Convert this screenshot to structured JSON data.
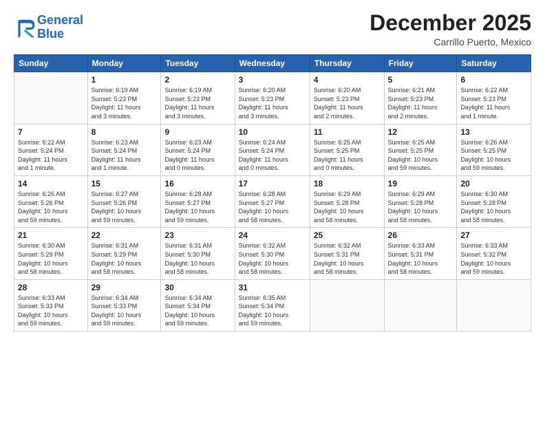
{
  "header": {
    "logo_line1": "General",
    "logo_line2": "Blue",
    "month": "December 2025",
    "location": "Carrillo Puerto, Mexico"
  },
  "weekdays": [
    "Sunday",
    "Monday",
    "Tuesday",
    "Wednesday",
    "Thursday",
    "Friday",
    "Saturday"
  ],
  "weeks": [
    [
      {
        "day": "",
        "info": ""
      },
      {
        "day": "1",
        "info": "Sunrise: 6:19 AM\nSunset: 5:23 PM\nDaylight: 11 hours\nand 3 minutes."
      },
      {
        "day": "2",
        "info": "Sunrise: 6:19 AM\nSunset: 5:23 PM\nDaylight: 11 hours\nand 3 minutes."
      },
      {
        "day": "3",
        "info": "Sunrise: 6:20 AM\nSunset: 5:23 PM\nDaylight: 11 hours\nand 3 minutes."
      },
      {
        "day": "4",
        "info": "Sunrise: 6:20 AM\nSunset: 5:23 PM\nDaylight: 11 hours\nand 2 minutes."
      },
      {
        "day": "5",
        "info": "Sunrise: 6:21 AM\nSunset: 5:23 PM\nDaylight: 11 hours\nand 2 minutes."
      },
      {
        "day": "6",
        "info": "Sunrise: 6:22 AM\nSunset: 5:23 PM\nDaylight: 11 hours\nand 1 minute."
      }
    ],
    [
      {
        "day": "7",
        "info": "Sunrise: 6:22 AM\nSunset: 5:24 PM\nDaylight: 11 hours\nand 1 minute."
      },
      {
        "day": "8",
        "info": "Sunrise: 6:23 AM\nSunset: 5:24 PM\nDaylight: 11 hours\nand 1 minute."
      },
      {
        "day": "9",
        "info": "Sunrise: 6:23 AM\nSunset: 5:24 PM\nDaylight: 11 hours\nand 0 minutes."
      },
      {
        "day": "10",
        "info": "Sunrise: 6:24 AM\nSunset: 5:24 PM\nDaylight: 11 hours\nand 0 minutes."
      },
      {
        "day": "11",
        "info": "Sunrise: 6:25 AM\nSunset: 5:25 PM\nDaylight: 11 hours\nand 0 minutes."
      },
      {
        "day": "12",
        "info": "Sunrise: 6:25 AM\nSunset: 5:25 PM\nDaylight: 10 hours\nand 59 minutes."
      },
      {
        "day": "13",
        "info": "Sunrise: 6:26 AM\nSunset: 5:25 PM\nDaylight: 10 hours\nand 59 minutes."
      }
    ],
    [
      {
        "day": "14",
        "info": "Sunrise: 6:26 AM\nSunset: 5:26 PM\nDaylight: 10 hours\nand 59 minutes."
      },
      {
        "day": "15",
        "info": "Sunrise: 6:27 AM\nSunset: 5:26 PM\nDaylight: 10 hours\nand 59 minutes."
      },
      {
        "day": "16",
        "info": "Sunrise: 6:28 AM\nSunset: 5:27 PM\nDaylight: 10 hours\nand 59 minutes."
      },
      {
        "day": "17",
        "info": "Sunrise: 6:28 AM\nSunset: 5:27 PM\nDaylight: 10 hours\nand 58 minutes."
      },
      {
        "day": "18",
        "info": "Sunrise: 6:29 AM\nSunset: 5:28 PM\nDaylight: 10 hours\nand 58 minutes."
      },
      {
        "day": "19",
        "info": "Sunrise: 6:29 AM\nSunset: 5:28 PM\nDaylight: 10 hours\nand 58 minutes."
      },
      {
        "day": "20",
        "info": "Sunrise: 6:30 AM\nSunset: 5:28 PM\nDaylight: 10 hours\nand 58 minutes."
      }
    ],
    [
      {
        "day": "21",
        "info": "Sunrise: 6:30 AM\nSunset: 5:29 PM\nDaylight: 10 hours\nand 58 minutes."
      },
      {
        "day": "22",
        "info": "Sunrise: 6:31 AM\nSunset: 5:29 PM\nDaylight: 10 hours\nand 58 minutes."
      },
      {
        "day": "23",
        "info": "Sunrise: 6:31 AM\nSunset: 5:30 PM\nDaylight: 10 hours\nand 58 minutes."
      },
      {
        "day": "24",
        "info": "Sunrise: 6:32 AM\nSunset: 5:30 PM\nDaylight: 10 hours\nand 58 minutes."
      },
      {
        "day": "25",
        "info": "Sunrise: 6:32 AM\nSunset: 5:31 PM\nDaylight: 10 hours\nand 58 minutes."
      },
      {
        "day": "26",
        "info": "Sunrise: 6:33 AM\nSunset: 5:31 PM\nDaylight: 10 hours\nand 58 minutes."
      },
      {
        "day": "27",
        "info": "Sunrise: 6:33 AM\nSunset: 5:32 PM\nDaylight: 10 hours\nand 59 minutes."
      }
    ],
    [
      {
        "day": "28",
        "info": "Sunrise: 6:33 AM\nSunset: 5:33 PM\nDaylight: 10 hours\nand 59 minutes."
      },
      {
        "day": "29",
        "info": "Sunrise: 6:34 AM\nSunset: 5:33 PM\nDaylight: 10 hours\nand 59 minutes."
      },
      {
        "day": "30",
        "info": "Sunrise: 6:34 AM\nSunset: 5:34 PM\nDaylight: 10 hours\nand 59 minutes."
      },
      {
        "day": "31",
        "info": "Sunrise: 6:35 AM\nSunset: 5:34 PM\nDaylight: 10 hours\nand 59 minutes."
      },
      {
        "day": "",
        "info": ""
      },
      {
        "day": "",
        "info": ""
      },
      {
        "day": "",
        "info": ""
      }
    ]
  ]
}
